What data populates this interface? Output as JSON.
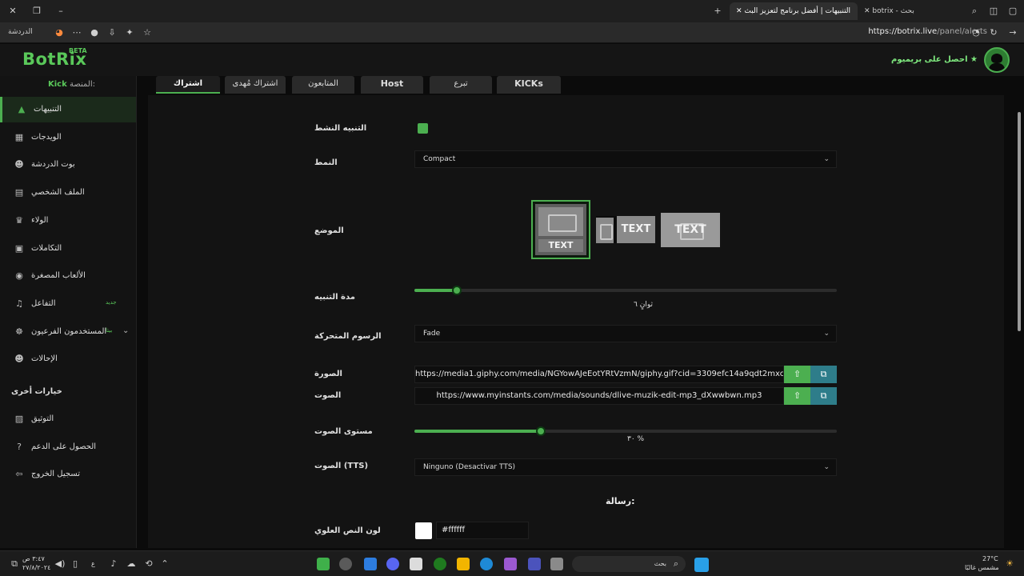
{
  "browser": {
    "tabs": [
      {
        "label": "التنبيهات | أفضل برنامج لتعزيز البث",
        "active": true
      },
      {
        "label": "botrix - بحث",
        "active": false
      }
    ],
    "url_host": "https://botrix.live",
    "url_path": "/panel/alerts",
    "left_label": "الدردشة"
  },
  "header": {
    "logo": "BotRix",
    "beta": "BETA",
    "premium": "احصل على بريميوم"
  },
  "sidebar": {
    "platform_label": "المنصة:",
    "platform_value": "Kick",
    "items": [
      {
        "label": "التنبيهات",
        "icon": "warning-icon",
        "glyph": "▲"
      },
      {
        "label": "الويدجات",
        "icon": "widgets-icon",
        "glyph": "▦"
      },
      {
        "label": "بوت الدردشة",
        "icon": "robot-icon",
        "glyph": "☻"
      },
      {
        "label": "الملف الشخصي",
        "icon": "profile-card-icon",
        "glyph": "▤"
      },
      {
        "label": "الولاء",
        "icon": "trophy-icon",
        "glyph": "♛"
      },
      {
        "label": "التكاملات",
        "icon": "integration-icon",
        "glyph": "▣"
      },
      {
        "label": "الألعاب المصغرة",
        "icon": "gamepad-icon",
        "glyph": "◉"
      },
      {
        "label": "التفاعل",
        "icon": "music-icon",
        "glyph": "♫",
        "badge": "جديد"
      },
      {
        "label": "المستخدمون الفرعيون",
        "icon": "users-gear-icon",
        "glyph": "☸",
        "badge": "بيتا"
      },
      {
        "label": "الإحالات",
        "icon": "referral-icon",
        "glyph": "☻"
      }
    ],
    "other_options_title": "خيارات أخرى",
    "other_items": [
      {
        "label": "التوثيق",
        "icon": "docs-icon",
        "glyph": "▨"
      },
      {
        "label": "الحصول على الدعم",
        "icon": "help-icon",
        "glyph": "?"
      },
      {
        "label": "تسجيل الخروج",
        "icon": "logout-icon",
        "glyph": "⇦"
      }
    ]
  },
  "tabs": [
    {
      "label": "اشتراك",
      "active": true
    },
    {
      "label": "اشتراك مُهدى",
      "active": false
    },
    {
      "label": "المتابعون",
      "active": false
    },
    {
      "label": "Host",
      "active": false
    },
    {
      "label": "تبرع",
      "active": false
    },
    {
      "label": "KICKs",
      "active": false
    }
  ],
  "form": {
    "active_label": "التنبيه النشط",
    "active_on": true,
    "style_label": "النمط",
    "style_value": "Compact",
    "position_label": "الموضع",
    "layout_text": "TEXT",
    "duration_label": "مدة التنبيه",
    "duration_value": 6,
    "duration_max": 60,
    "duration_text": "ثوانٍ ٦",
    "animation_label": "الرسوم المتحركة",
    "animation_value": "Fade",
    "image_label": "الصورة",
    "image_value": "https://media1.giphy.com/media/NGYowAJeEotYRtVzmN/giphy.gif?cid=3309efc14a9qdt2mxc",
    "sound_label": "الصوت",
    "sound_value": "https://www.myinstants.com/media/sounds/dlive-muzik-edit-mp3_dXwwbwn.mp3",
    "volume_label": "مستوى الصوت",
    "volume_value": 30,
    "volume_text": "٣٠ %",
    "tts_label": "الصوت (TTS)",
    "tts_value": "Ninguno (Desactivar TTS)",
    "message_title": "رسالة:",
    "top_color_label": "لون النص العلوي",
    "top_color_value": "#ffffff"
  },
  "taskbar": {
    "time": "٣:٤٧ ص",
    "date": "٢٧/٨/٢٠٢٤",
    "weather_temp": "27°C",
    "weather_desc": "مشمس غالبًا",
    "search_label": "بحث",
    "lang": "ع"
  },
  "colors": {
    "accent": "#4caf50",
    "brand": "#5ac85a"
  }
}
